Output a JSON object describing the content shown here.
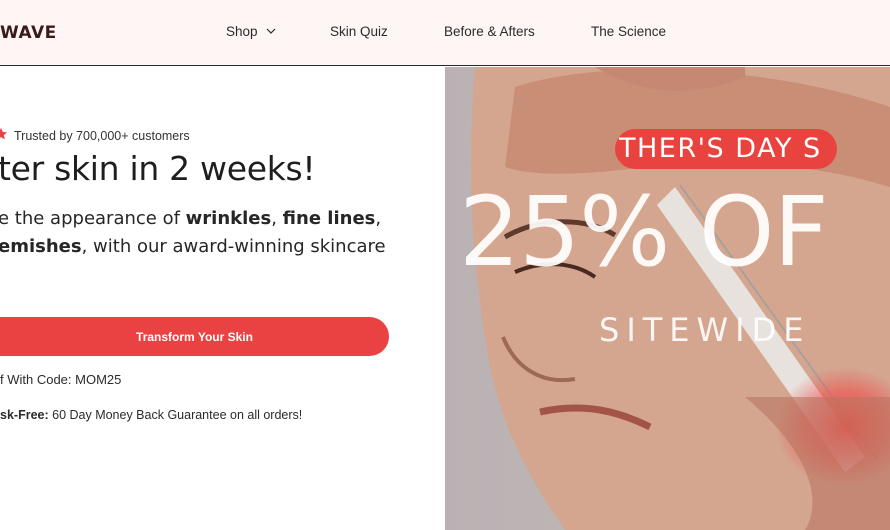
{
  "header": {
    "logo_text": "WAVE",
    "nav": {
      "shop": "Shop",
      "skin_quiz": "Skin Quiz",
      "before_afters": "Before & Afters",
      "science": "The Science"
    }
  },
  "hero_left": {
    "trust_text": "Trusted by 700,000+ customers",
    "headline": "ter skin in 2 weeks!",
    "sub_part1": "e the appearance of ",
    "sub_bold1": "wrinkles",
    "sub_part2": ", ",
    "sub_bold2": "fine lines",
    "sub_part3": ",",
    "sub_bold3": "emishes",
    "sub_part4": ", with our award-winning skincare",
    "cta_label": "Transform Your Skin",
    "code_line": "f With Code: MOM25",
    "guarantee_bold": "sk-Free:",
    "guarantee_text": " 60 Day Money Back Guarantee on all orders!"
  },
  "promo": {
    "pill_text": "THER'S DAY S",
    "big_text": "25% OF",
    "sitewide": "SITEWIDE"
  },
  "colors": {
    "accent": "#ea4242",
    "nav_bg": "#fdf6f4"
  },
  "icons": {
    "star": "star-icon",
    "chevron": "chevron-down-icon"
  }
}
